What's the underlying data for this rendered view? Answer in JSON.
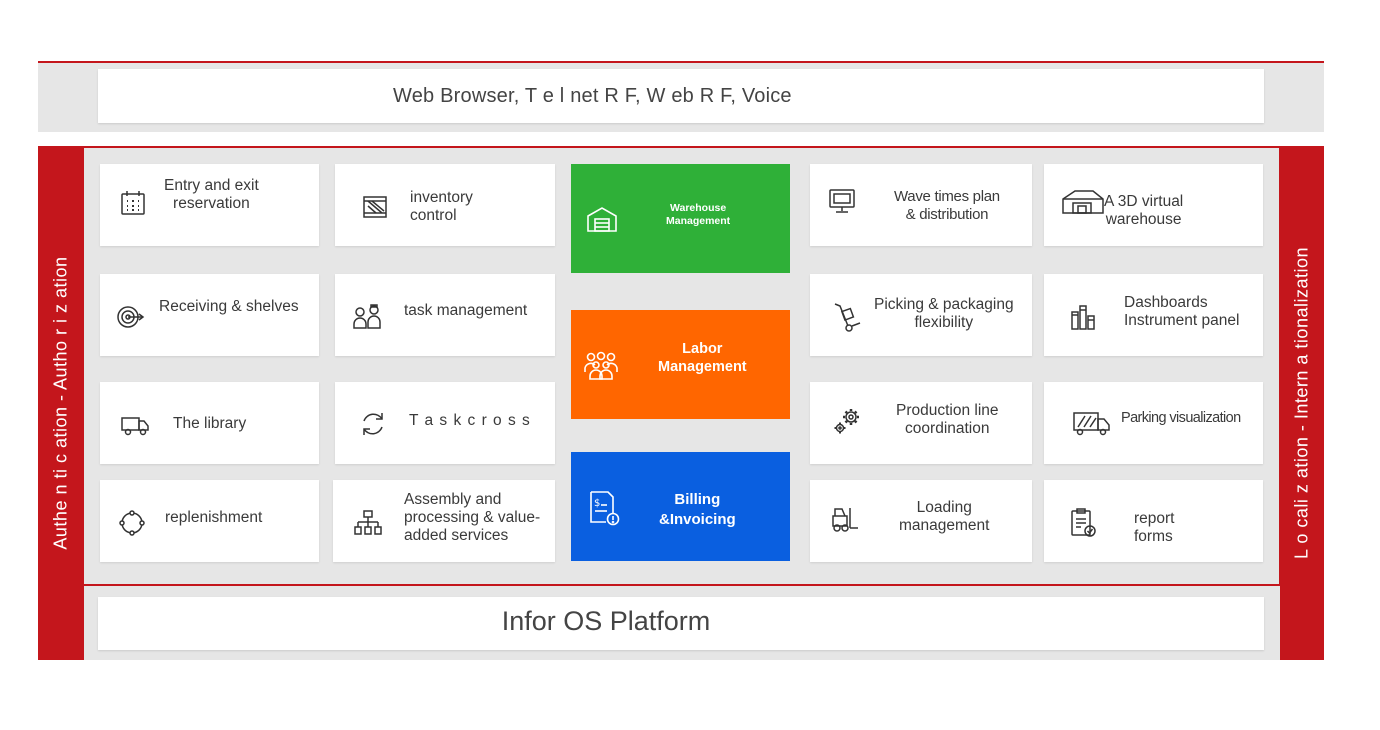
{
  "top_bar": {
    "label": "Web Browser, T e l net R F, W eb R F, Voice"
  },
  "left_bar": {
    "label": "Authe n ti c ation - Autho r i z ation"
  },
  "right_bar": {
    "label": "L o cali z ation - Intern a tionalization"
  },
  "bottom_bar": {
    "label": "Infor OS Platform"
  },
  "colors": {
    "accent_red": "#c4161c",
    "warehouse_green": "#2fb038",
    "labor_orange": "#ff6600",
    "billing_blue": "#0a5fe0",
    "band_gray": "#e6e6e6"
  },
  "modules": {
    "left_col1": [
      {
        "label": "Entry and exit\nreservation",
        "icon": "calendar-icon"
      },
      {
        "label": "Receiving & shelves",
        "icon": "target-icon"
      },
      {
        "label": "The library",
        "icon": "truck-icon"
      },
      {
        "label": "replenishment",
        "icon": "cycle-icon"
      }
    ],
    "left_col2": [
      {
        "label": "inventory\ncontrol",
        "icon": "crate-icon"
      },
      {
        "label": "task management",
        "icon": "people-icon"
      },
      {
        "label": "T a s k  c r o s s",
        "icon": "refresh-icon"
      },
      {
        "label": "Assembly and\nprocessing & value-\nadded services",
        "icon": "hierarchy-icon"
      }
    ],
    "center": [
      {
        "label": "Warehouse\nManagement",
        "icon": "warehouse-icon"
      },
      {
        "label": "Labor\nManagement",
        "icon": "group-icon"
      },
      {
        "label": "Billing\n&Invoicing",
        "icon": "invoice-icon"
      }
    ],
    "right_col1": [
      {
        "label": "Wave times plan\n& distribution",
        "icon": "monitor-icon"
      },
      {
        "label": "Picking & packaging\nflexibility",
        "icon": "hand-truck-icon"
      },
      {
        "label": "Production line\ncoordination",
        "icon": "gears-icon"
      },
      {
        "label": "Loading\nmanagement",
        "icon": "forklift-icon"
      }
    ],
    "right_col2": [
      {
        "label": "A 3D virtual\nwarehouse",
        "icon": "warehouse-3d-icon"
      },
      {
        "label": "Dashboards\nInstrument panel",
        "icon": "bar-chart-icon"
      },
      {
        "label": "Parking visualization",
        "icon": "parking-truck-icon"
      },
      {
        "label": "report\nforms",
        "icon": "report-icon"
      }
    ]
  }
}
